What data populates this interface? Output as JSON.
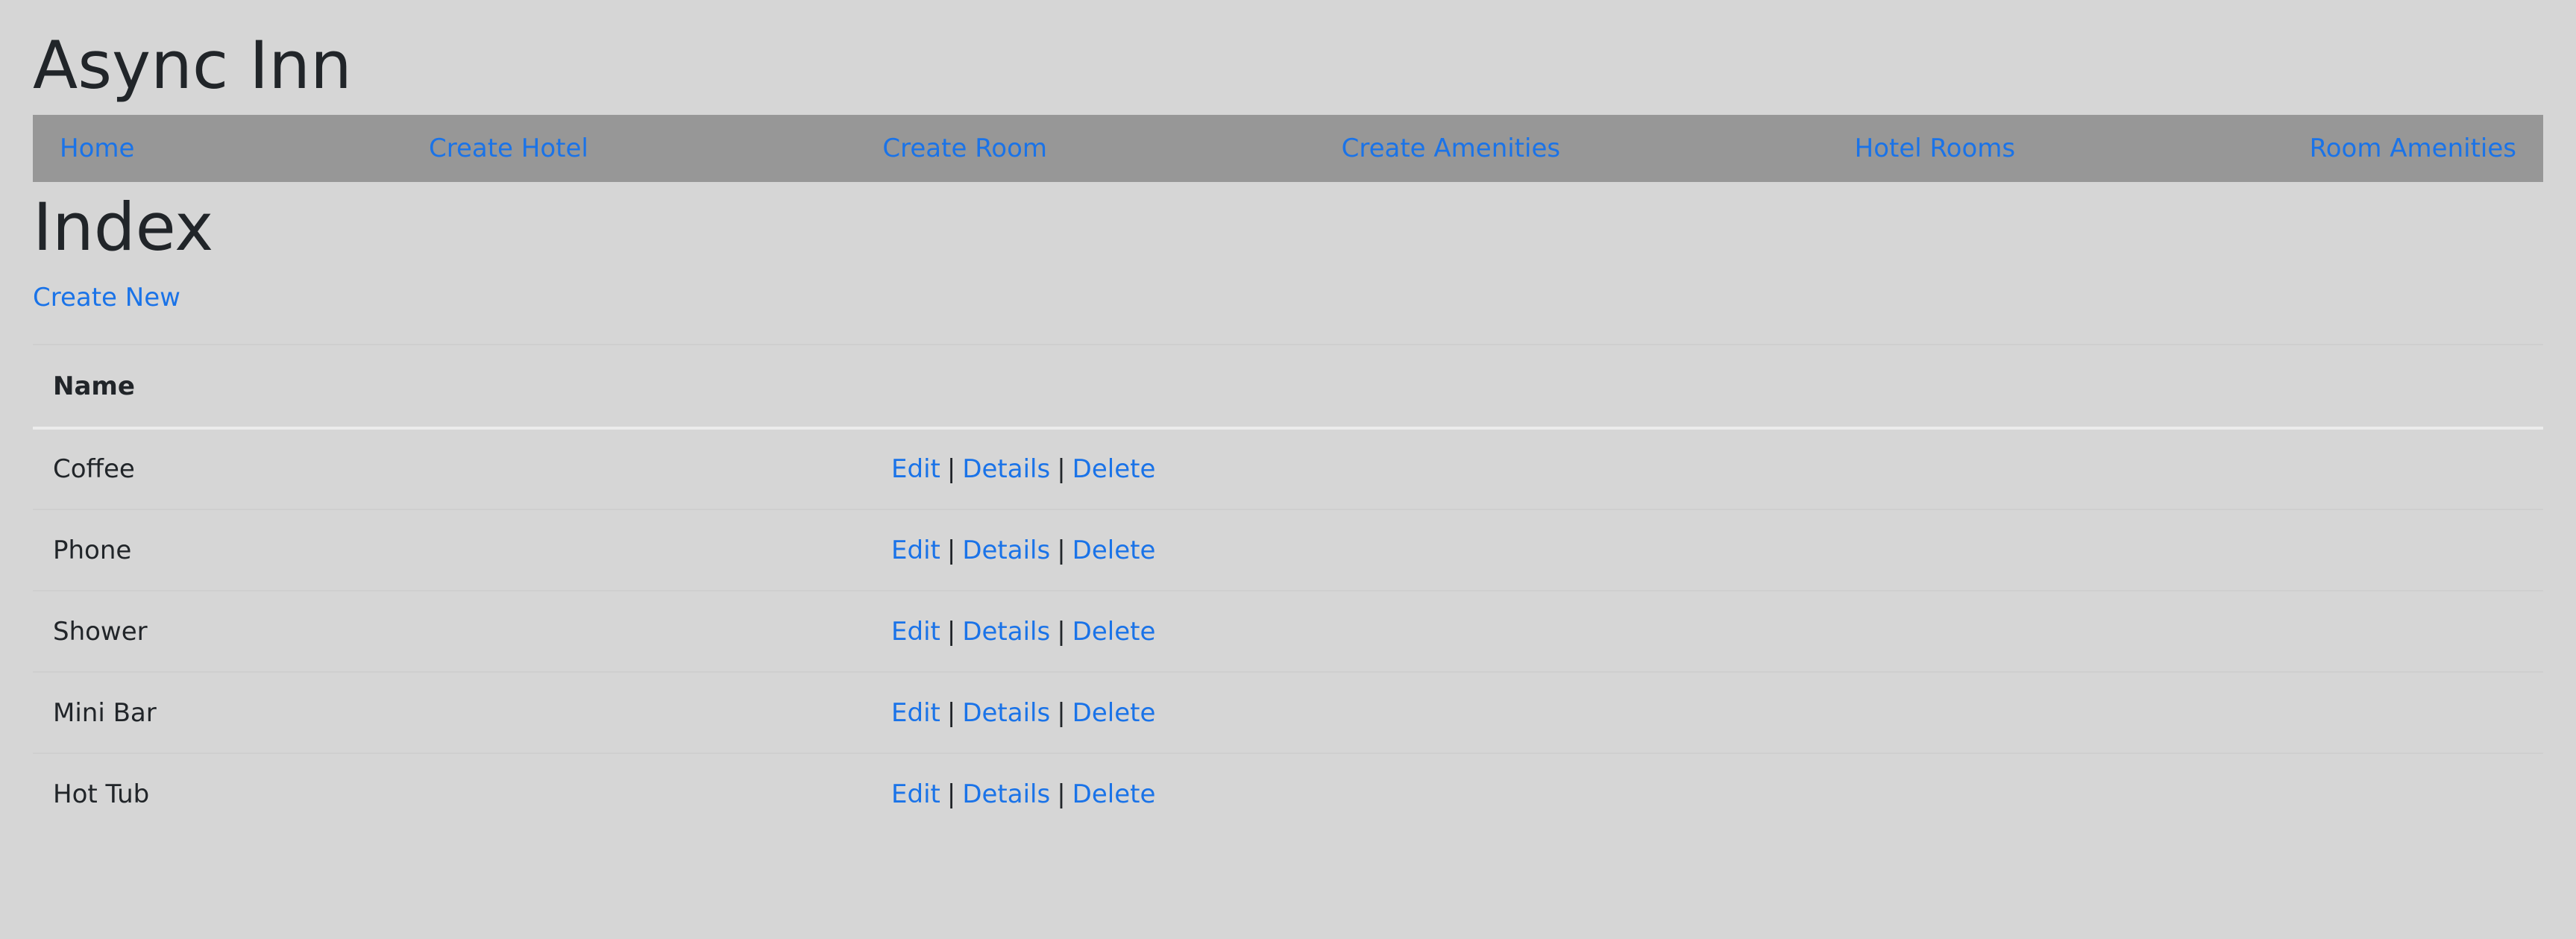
{
  "header": {
    "site_title": "Async Inn"
  },
  "nav": {
    "items": [
      {
        "label": "Home"
      },
      {
        "label": "Create Hotel"
      },
      {
        "label": "Create Room"
      },
      {
        "label": "Create Amenities"
      },
      {
        "label": "Hotel Rooms"
      },
      {
        "label": "Room Amenities"
      }
    ]
  },
  "main": {
    "title": "Index",
    "create_new_label": "Create New",
    "table": {
      "columns": [
        "Name",
        ""
      ],
      "rows": [
        {
          "name": "Coffee"
        },
        {
          "name": "Phone"
        },
        {
          "name": "Shower"
        },
        {
          "name": "Mini Bar"
        },
        {
          "name": "Hot Tub"
        }
      ],
      "actions": {
        "edit": "Edit",
        "details": "Details",
        "delete": "Delete",
        "separator": "|"
      }
    }
  },
  "colors": {
    "page_background": "#d6d6d6",
    "navbar_background": "#979797",
    "link": "#1a73e8",
    "text": "#212529"
  }
}
